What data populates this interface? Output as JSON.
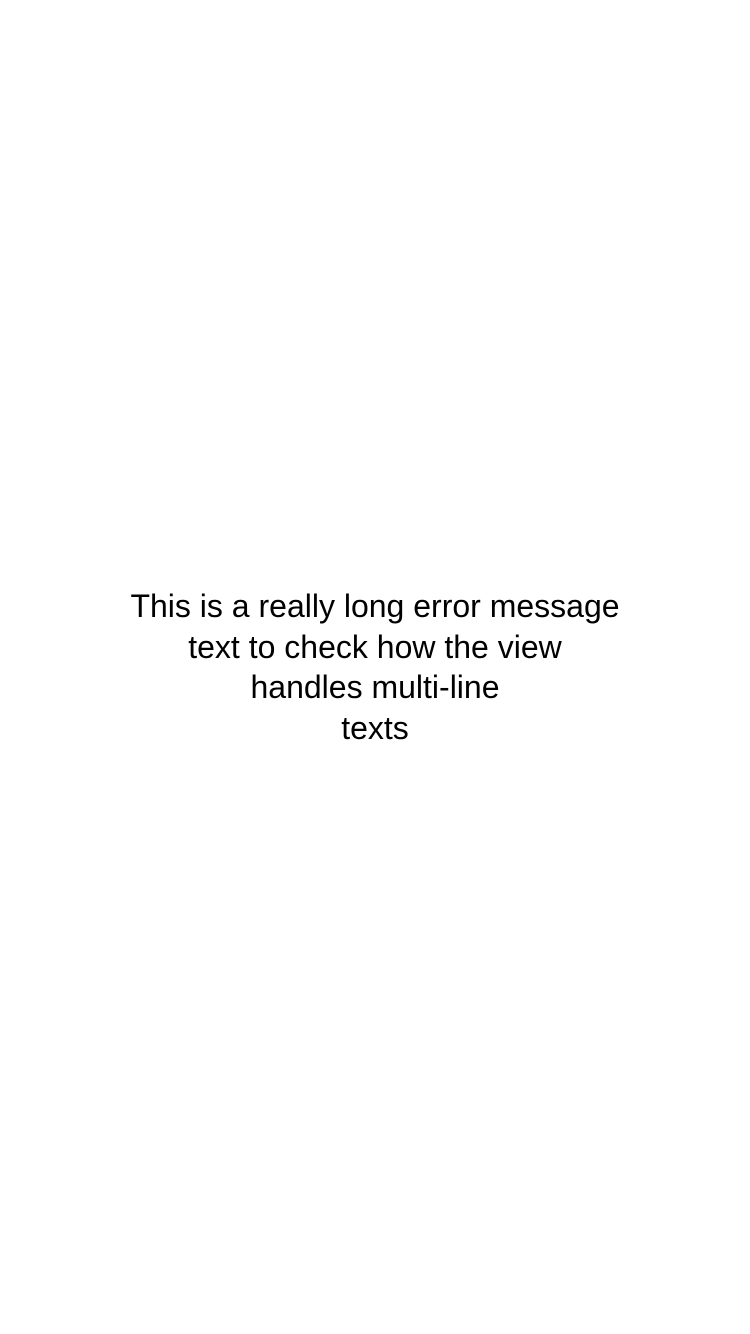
{
  "error_view": {
    "message_lines": [
      "This is a really long error message",
      "text to check how the view",
      "handles multi-line",
      "texts"
    ]
  }
}
